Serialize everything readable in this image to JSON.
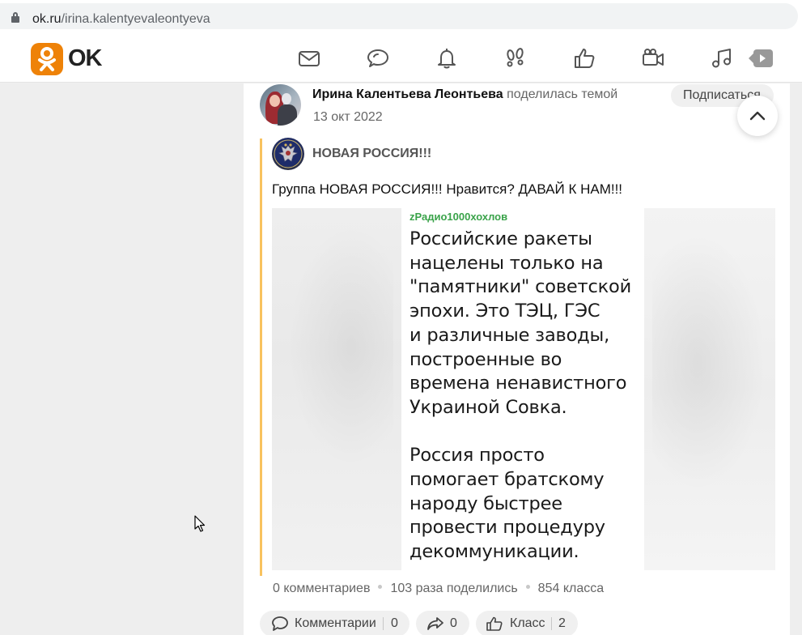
{
  "browser": {
    "url_host": "ok.ru",
    "url_path": "/irina.kalentyevaleontyeva"
  },
  "header": {
    "logo_text": "OK",
    "nav_icons": [
      "envelope-icon",
      "chat-bubble-icon",
      "bell-icon",
      "footprints-icon",
      "thumbs-up-icon",
      "camera-icon",
      "music-icon",
      "video-play-icon"
    ]
  },
  "post": {
    "author_name": "Ирина Калентьева Леонтьева",
    "author_action": "поделилась темой",
    "date": "13 окт 2022",
    "subscribe_label": "Подписаться",
    "group_name": "НОВАЯ РОССИЯ!!!",
    "text": "Группа НОВАЯ РОССИЯ!!! Нравится? ДАВАЙ К НАМ!!!",
    "image": {
      "source_label": "zРадио1000хохлов",
      "body": "Российские ракеты\nнацелены только на\n\"памятники\" советской\nэпохи. Это ТЭЦ, ГЭС\nи различные заводы,\nпостроенные во\nвремена ненавистного\nУкраиной Совка.\n\nРоссия просто\nпомогает братскому\nнароду быстрее\nпровести процедуру\nдекоммуникации."
    },
    "stats": {
      "comments": "0 комментариев",
      "shares": "103 раза поделились",
      "likes": "854 класса"
    },
    "actions": {
      "comments_label": "Комментарии",
      "comments_count": "0",
      "share_count": "0",
      "like_label": "Класс",
      "like_count": "2"
    }
  },
  "colors": {
    "ok_orange": "#ee8208",
    "quote_bar": "#f8c25e",
    "source_green": "#3aa34a"
  }
}
